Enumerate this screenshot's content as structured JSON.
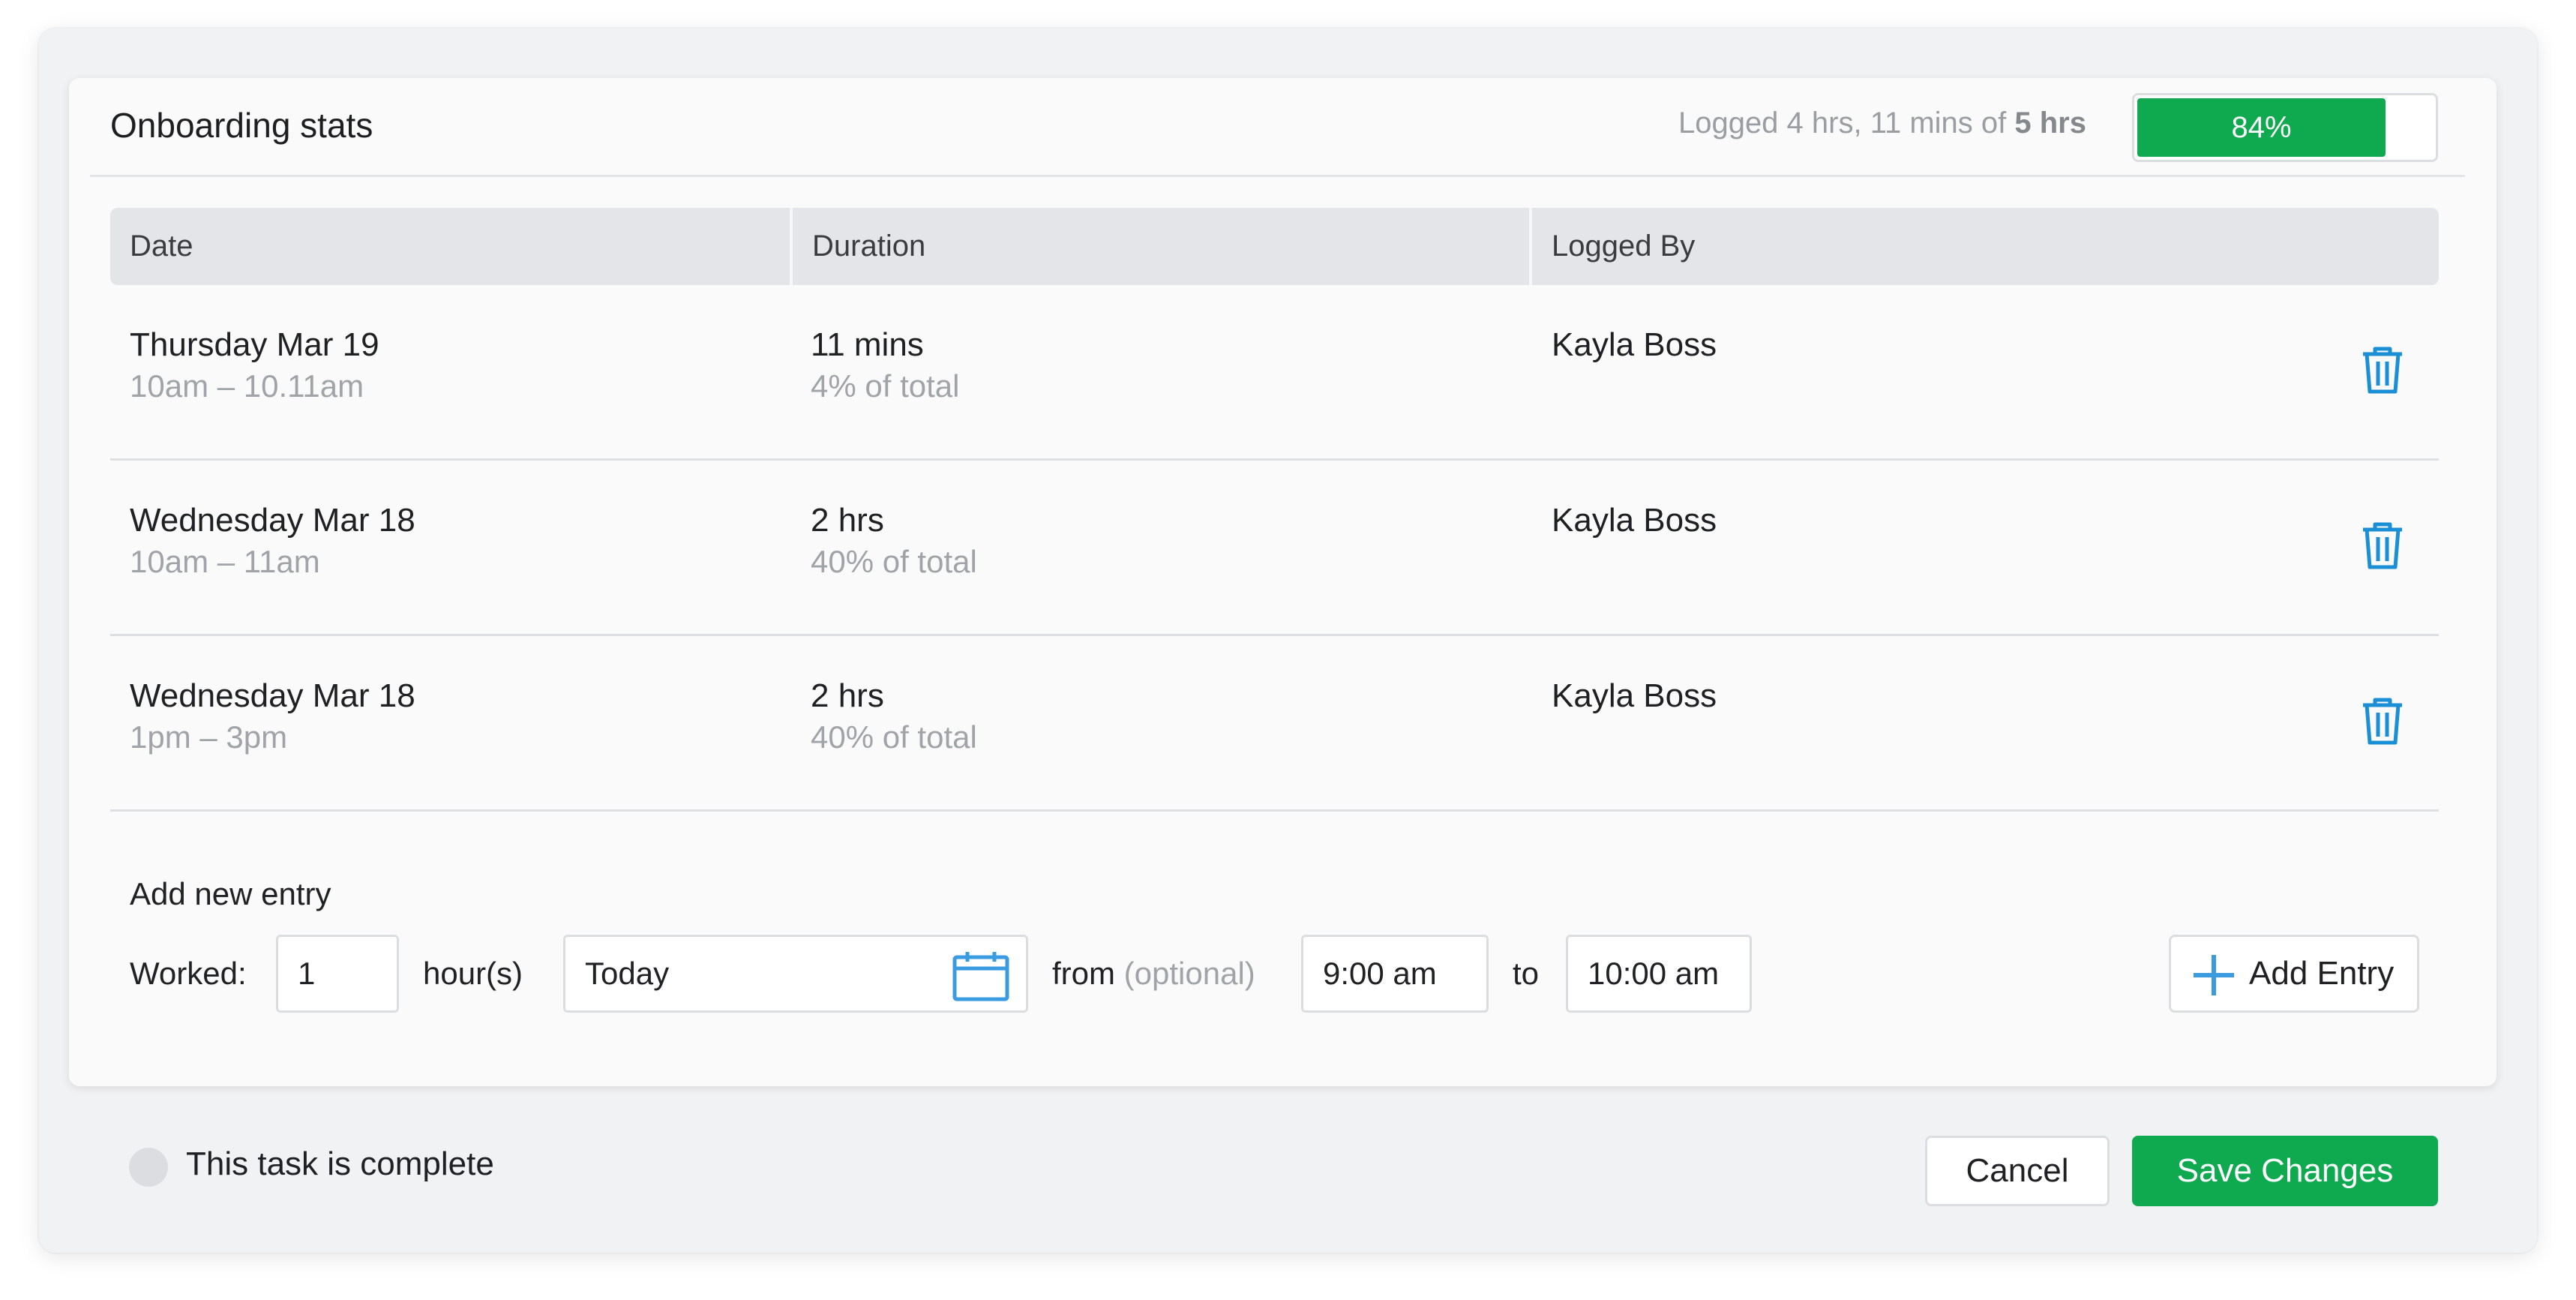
{
  "header": {
    "title": "Onboarding stats",
    "logged_prefix": "Logged 4 hrs, 11 mins of",
    "logged_total": "5 hrs",
    "progress_label": "84%",
    "progress_percent": 84,
    "accent_color": "#0fa94f"
  },
  "table": {
    "columns": [
      "Date",
      "Duration",
      "Logged By"
    ],
    "rows": [
      {
        "date": "Thursday Mar 19",
        "time": "10am – 10.11am",
        "duration": "11 mins",
        "share": "4% of total",
        "logged_by": "Kayla Boss"
      },
      {
        "date": "Wednesday Mar 18",
        "time": "10am – 11am",
        "duration": "2 hrs",
        "share": "40% of total",
        "logged_by": "Kayla Boss"
      },
      {
        "date": "Wednesday Mar 18",
        "time": "1pm – 3pm",
        "duration": "2 hrs",
        "share": "40% of total",
        "logged_by": "Kayla Boss"
      }
    ],
    "delete_icon": "trash-icon",
    "delete_icon_color": "#1b8fd6"
  },
  "new_entry": {
    "title": "Add new entry",
    "worked_label": "Worked:",
    "hours_value": "1",
    "hours_unit": "hour(s)",
    "date_value": "Today",
    "calendar_icon": "calendar-icon",
    "from_label": "from",
    "from_optional": "(optional)",
    "from_value": "9:00 am",
    "to_label": "to",
    "to_value": "10:00 am",
    "add_button_label": "Add Entry",
    "add_icon": "plus-icon"
  },
  "footer": {
    "complete_label": "This task is complete",
    "cancel_label": "Cancel",
    "save_label": "Save Changes"
  }
}
